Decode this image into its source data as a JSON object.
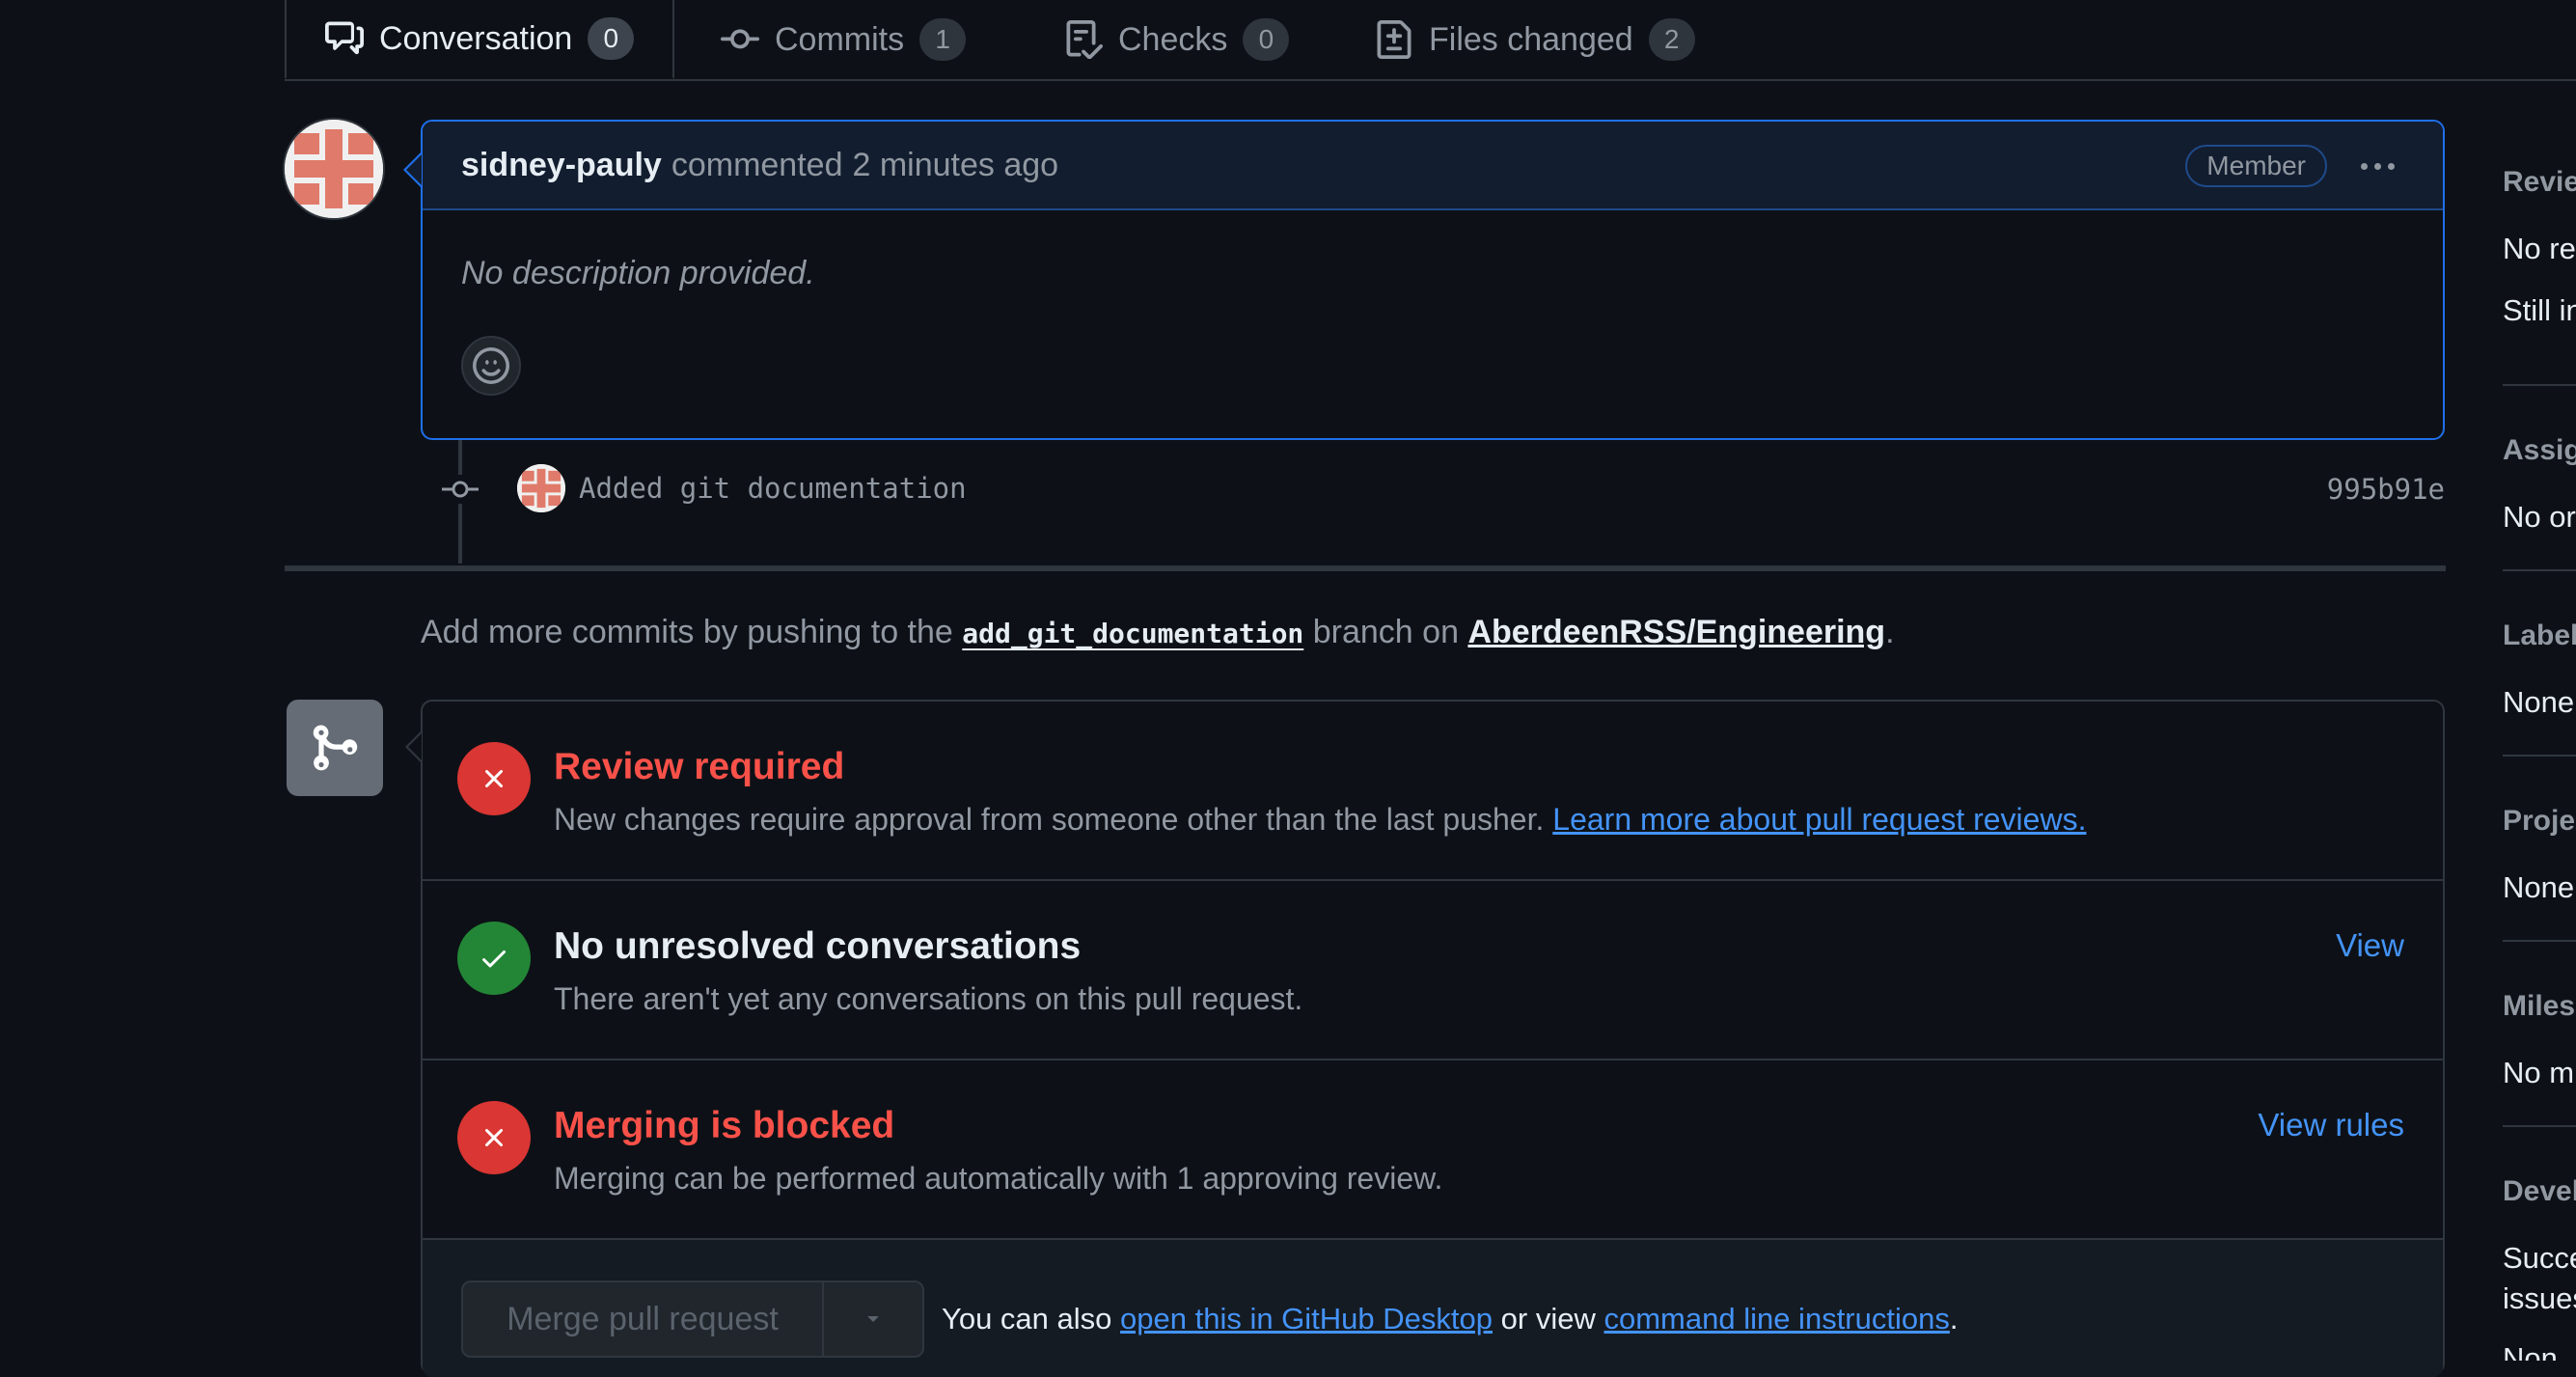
{
  "tabs": [
    {
      "label": "Conversation",
      "count": "0",
      "icon": "conversation-icon"
    },
    {
      "label": "Commits",
      "count": "1",
      "icon": "commit-icon"
    },
    {
      "label": "Checks",
      "count": "0",
      "icon": "checks-icon"
    },
    {
      "label": "Files changed",
      "count": "2",
      "icon": "diff-icon"
    }
  ],
  "comment": {
    "author": "sidney-pauly",
    "action": "commented",
    "time": "2 minutes ago",
    "badge": "Member",
    "body": "No description provided."
  },
  "commit": {
    "message": "Added git documentation",
    "sha": "995b91e"
  },
  "push_info": {
    "prefix": "Add more commits by pushing to the",
    "branch": "add_git_documentation",
    "middle": "branch on",
    "repo": "AberdeenRSS/Engineering",
    "suffix": "."
  },
  "merge_checks": [
    {
      "status": "failure",
      "title": "Review required",
      "description": "New changes require approval from someone other than the last pusher.",
      "link": "Learn more about pull request reviews."
    },
    {
      "status": "success",
      "title": "No unresolved conversations",
      "description": "There aren't yet any conversations on this pull request.",
      "action": "View"
    },
    {
      "status": "failure",
      "title": "Merging is blocked",
      "description": "Merging can be performed automatically with 1 approving review.",
      "action": "View rules"
    }
  ],
  "merge_footer": {
    "button": "Merge pull request",
    "text_prefix": "You can also",
    "desktop_link": "open this in GitHub Desktop",
    "text_middle": "or view",
    "cli_link": "command line instructions",
    "text_suffix": "."
  },
  "sidebar": [
    {
      "heading": "Revie",
      "values": [
        "No re",
        "Still in"
      ]
    },
    {
      "heading": "Assig",
      "values": [
        "No or"
      ]
    },
    {
      "heading": "Label",
      "values": [
        "None"
      ]
    },
    {
      "heading": "Proje",
      "values": [
        "None"
      ]
    },
    {
      "heading": "Miles",
      "values": [
        "No m"
      ]
    },
    {
      "heading": "Devel",
      "values": [
        "Succe",
        "issues",
        "Non"
      ]
    }
  ],
  "colors": {
    "background": "#0d1117",
    "accent": "#4493f8",
    "danger": "#da3633",
    "success": "#238636"
  }
}
